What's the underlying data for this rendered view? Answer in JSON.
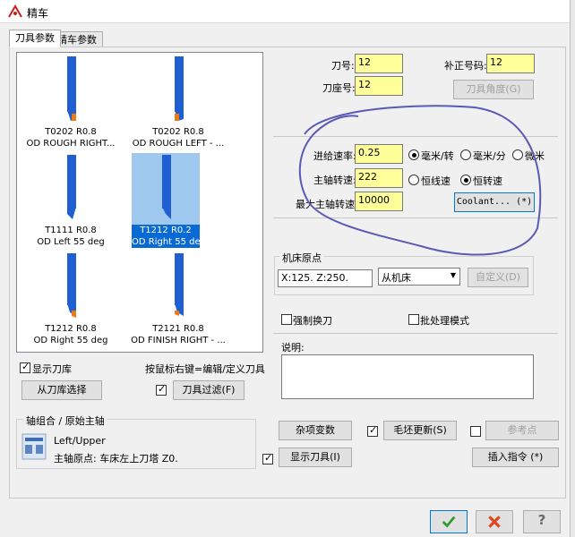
{
  "window": {
    "title": "精车"
  },
  "tabs": [
    {
      "label": "刀具参数",
      "active": true
    },
    {
      "label": "精车参数",
      "active": false
    }
  ],
  "tools": [
    {
      "line1": "T0202 R0.8",
      "line2": "OD ROUGH RIGHT...",
      "selected": false
    },
    {
      "line1": "T0202 R0.8",
      "line2": "OD ROUGH LEFT - ...",
      "selected": false
    },
    {
      "line1": "T1111 R0.8",
      "line2": "OD Left 55 deg",
      "selected": false
    },
    {
      "line1": "T1212 R0.2",
      "line2": "OD Right 55 deg",
      "selected": true
    },
    {
      "line1": "T1212 R0.8",
      "line2": "OD Right 55 deg",
      "selected": false
    },
    {
      "line1": "T2121 R0.8",
      "line2": "OD FINISH RIGHT - ...",
      "selected": false
    }
  ],
  "tool_params": {
    "tool_no_label": "刀号:",
    "tool_no": "12",
    "offset_no_label": "补正号码:",
    "offset_no": "12",
    "station_label": "刀座号:",
    "station": "12",
    "tool_angle_btn": "刀具角度(G)"
  },
  "speeds": {
    "feed_label": "进给速率:",
    "feed": "0.25",
    "spindle_label": "主轴转速:",
    "spindle": "222",
    "max_spindle_label": "最大主轴转速:",
    "max_spindle": "10000",
    "feed_units": [
      "毫米/转",
      "毫米/分",
      "微米"
    ],
    "spindle_modes": [
      "恒线速",
      "恒转速"
    ],
    "coolant_btn": "Coolant... (*)"
  },
  "machine_origin": {
    "group_label": "机床原点",
    "value": "X:125. Z:250.",
    "select_value": "从机床",
    "define_btn": "自定义(D)"
  },
  "options": {
    "force_change": "强制换刀",
    "batch_mode": "批处理模式",
    "comment_label": "说明:"
  },
  "left_controls": {
    "show_library": "显示刀库",
    "hint": "按鼠标右键=编辑/定义刀具",
    "select_from_library": "从刀库选择",
    "tool_filter": "刀具过滤(F)"
  },
  "axis_combo": {
    "group_label": "轴组合 / 原始主轴",
    "name": "Left/Upper",
    "origin_text": "主轴原点: 车床左上刀塔  Z0."
  },
  "bottom_buttons": {
    "misc_vars": "杂项变数",
    "stock_update": "毛坯更新(S)",
    "ref_point": "参考点",
    "display_tool": "显示刀具(I)",
    "insert_cmd": "插入指令 (*)"
  },
  "colors": {
    "field_yellow": "#ffff99",
    "selection_blue": "#0a6ad4",
    "ok_green": "#2f9a2f",
    "cancel_red": "#e0451b",
    "annotation_blue": "#5a5ab4"
  }
}
